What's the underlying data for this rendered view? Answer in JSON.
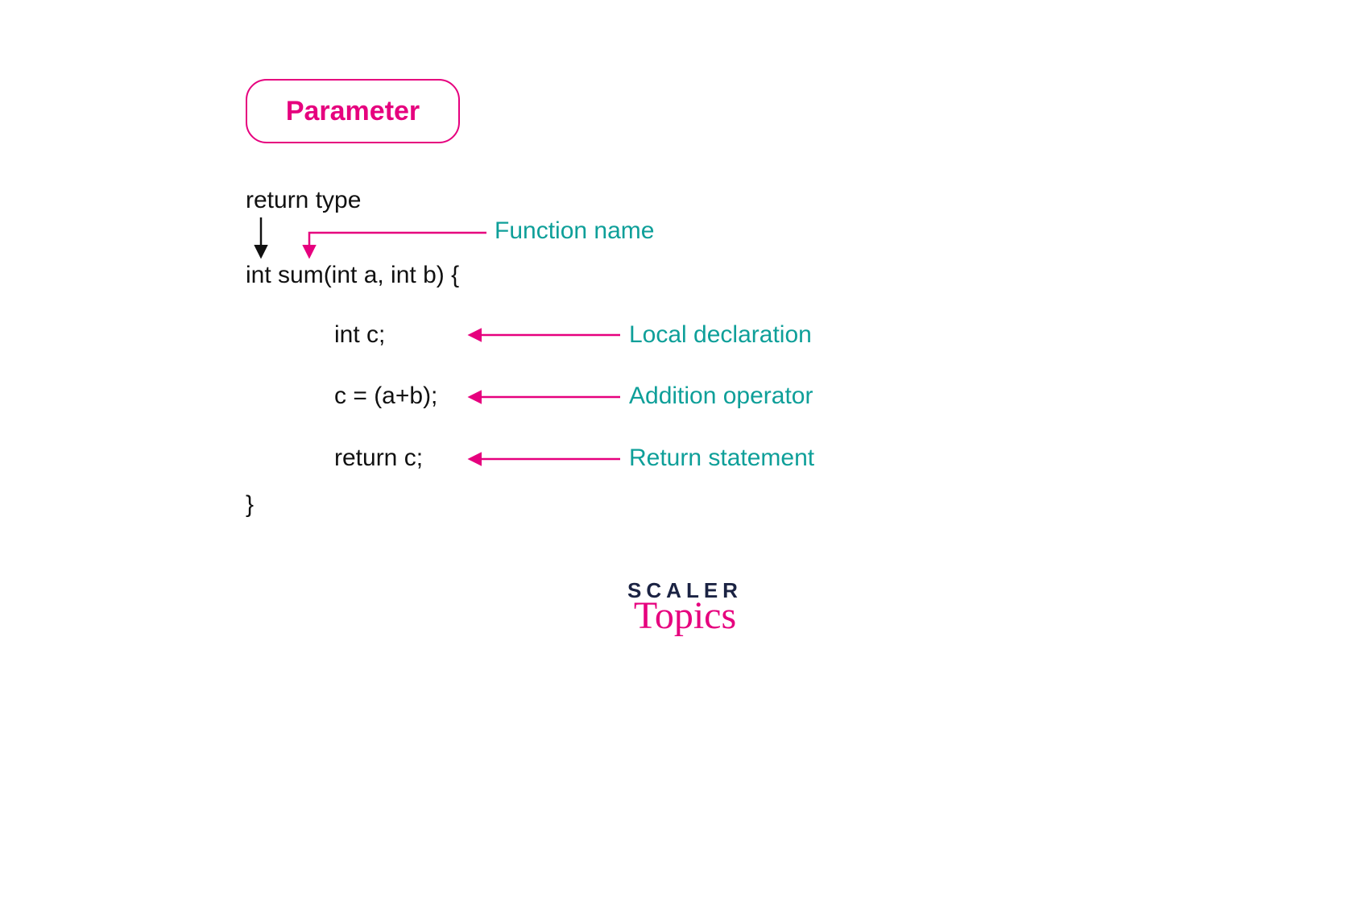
{
  "title_box": "Parameter",
  "code": {
    "return_type_label": "return type",
    "signature": "int sum(int a, int b) {",
    "local_decl": "int c;",
    "addition": "c = (a+b);",
    "return_stmt": "return c;",
    "close": "}"
  },
  "annotations": {
    "function_name": "Function name",
    "local_declaration": "Local declaration",
    "addition_operator": "Addition operator",
    "return_statement": "Return statement"
  },
  "logo": {
    "line1": "SCALER",
    "line2": "Topics"
  },
  "colors": {
    "pink": "#E6007E",
    "teal": "#0E9F99",
    "text": "#111111",
    "navy": "#1B2343"
  }
}
